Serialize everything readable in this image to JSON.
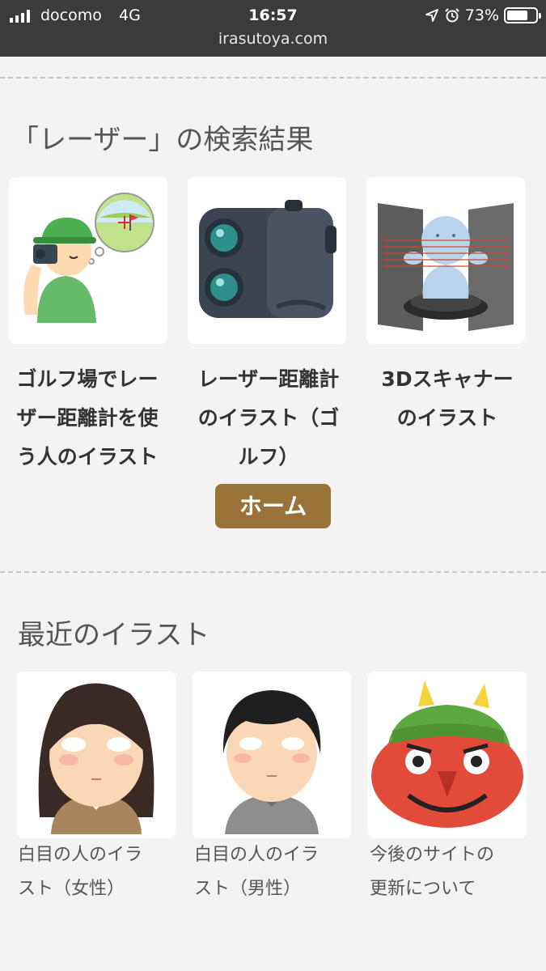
{
  "status_bar": {
    "carrier": "docomo",
    "network": "4G",
    "time": "16:57",
    "battery": "73%",
    "battery_level": 0.73,
    "url": "irasutoya.com"
  },
  "search": {
    "title": "「レーザー」の検索結果",
    "results": [
      {
        "title": "ゴルフ場でレーザー距離計を使う人のイラスト",
        "lines": [
          "ゴルフ場でレー",
          "ザー距離計を使",
          "う人のイラスト"
        ],
        "image_icon": "golfer-rangefinder-illustration"
      },
      {
        "title": "レーザー距離計のイラスト（ゴルフ）",
        "lines": [
          "レーザー距離計",
          "のイラスト（ゴ",
          "ルフ）"
        ],
        "image_icon": "laser-rangefinder-illustration"
      },
      {
        "title": "3Dスキャナーのイラスト",
        "lines": [
          "3Dスキャナー",
          "のイラスト"
        ],
        "image_icon": "3d-scanner-illustration"
      }
    ],
    "home_button": "ホーム"
  },
  "recent": {
    "title": "最近のイラスト",
    "items": [
      {
        "lines": [
          "白目の人のイラ",
          "スト（女性）"
        ],
        "image_icon": "white-eyes-woman-illustration"
      },
      {
        "lines": [
          "白目の人のイラ",
          "スト（男性）"
        ],
        "image_icon": "white-eyes-man-illustration"
      },
      {
        "lines": [
          "今後のサイトの",
          "更新について"
        ],
        "image_icon": "red-oni-illustration"
      }
    ]
  }
}
